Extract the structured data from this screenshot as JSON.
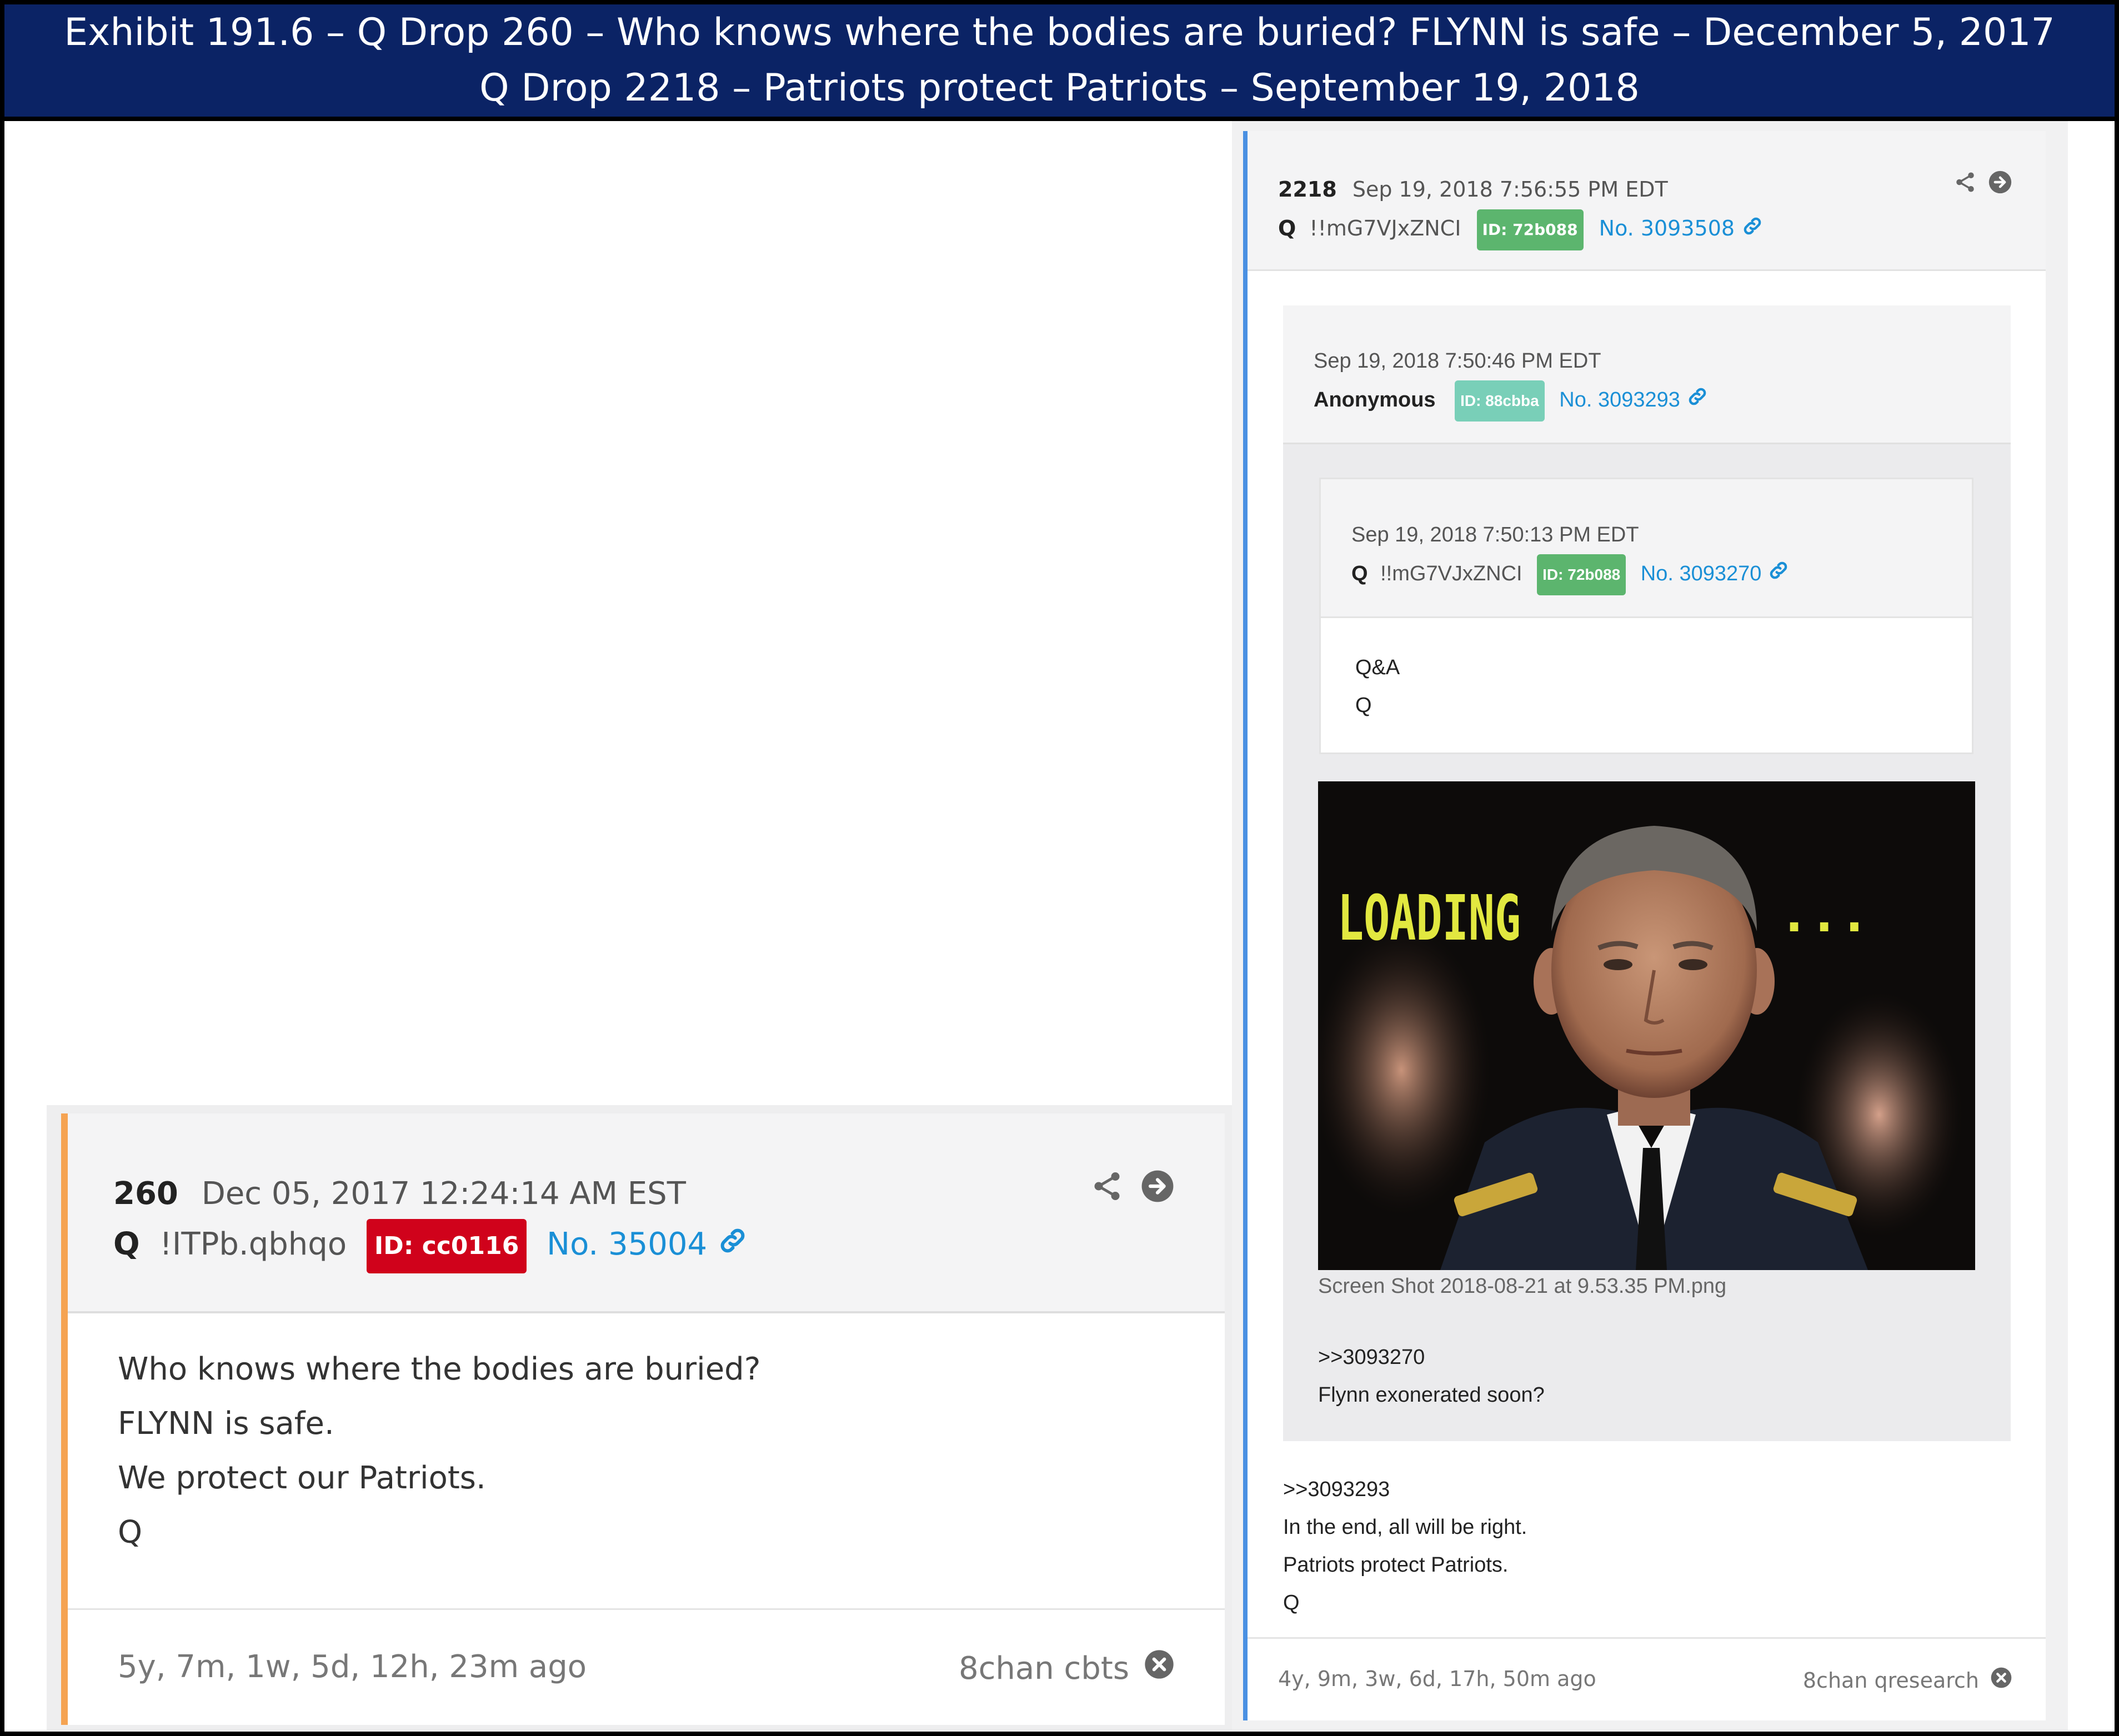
{
  "header": {
    "line1": "Exhibit 191.6 – Q Drop 260 – Who knows where the bodies are buried? FLYNN is safe – December 5, 2017",
    "line2": "Q Drop 2218 – Patriots protect Patriots – September 19, 2018"
  },
  "colors": {
    "header_bg": "#0b2365",
    "left_accent": "#f5a352",
    "right_accent": "#4a90e2",
    "link": "#1a8fd6",
    "id_red": "#d0021b",
    "id_green": "#5cb56e",
    "id_teal": "#79cfb8"
  },
  "post260": {
    "number": "260",
    "date": "Dec 05, 2017 12:24:14 AM EST",
    "name": "Q",
    "tripcode": "!ITPb.qbhqo",
    "id": "ID: cc0116",
    "post_no": "No. 35004",
    "body": [
      "Who knows where the bodies are buried?",
      "FLYNN is safe.",
      "We protect our Patriots.",
      "Q"
    ],
    "ago": "5y, 7m, 1w, 5d, 12h, 23m ago",
    "source": "8chan cbts",
    "icons": [
      "share-icon",
      "arrow-right-icon",
      "link-icon",
      "close-icon"
    ]
  },
  "post2218": {
    "number": "2218",
    "date": "Sep 19, 2018 7:56:55 PM EDT",
    "name": "Q",
    "tripcode": "!!mG7VJxZNCI",
    "id": "ID: 72b088",
    "post_no": "No. 3093508",
    "body": [
      ">>3093293",
      "In the end, all will be right.",
      "Patriots protect Patriots.",
      "Q"
    ],
    "ago": "4y, 9m, 3w, 6d, 17h, 50m ago",
    "source": "8chan qresearch",
    "quote": {
      "date": "Sep 19, 2018 7:50:46 PM EDT",
      "name": "Anonymous",
      "id": "ID: 88cbba",
      "post_no": "No. 3093293",
      "image_caption": "Screen Shot 2018-08-21 at 9.53.35 PM.png",
      "image_text": "LOADING",
      "image_dots": "...",
      "body": [
        ">>3093270",
        "Flynn exonerated soon?"
      ],
      "nested": {
        "date": "Sep 19, 2018 7:50:13 PM EDT",
        "name": "Q",
        "tripcode": "!!mG7VJxZNCI",
        "id": "ID: 72b088",
        "post_no": "No. 3093270",
        "body": [
          "Q&A",
          "Q"
        ]
      }
    }
  }
}
